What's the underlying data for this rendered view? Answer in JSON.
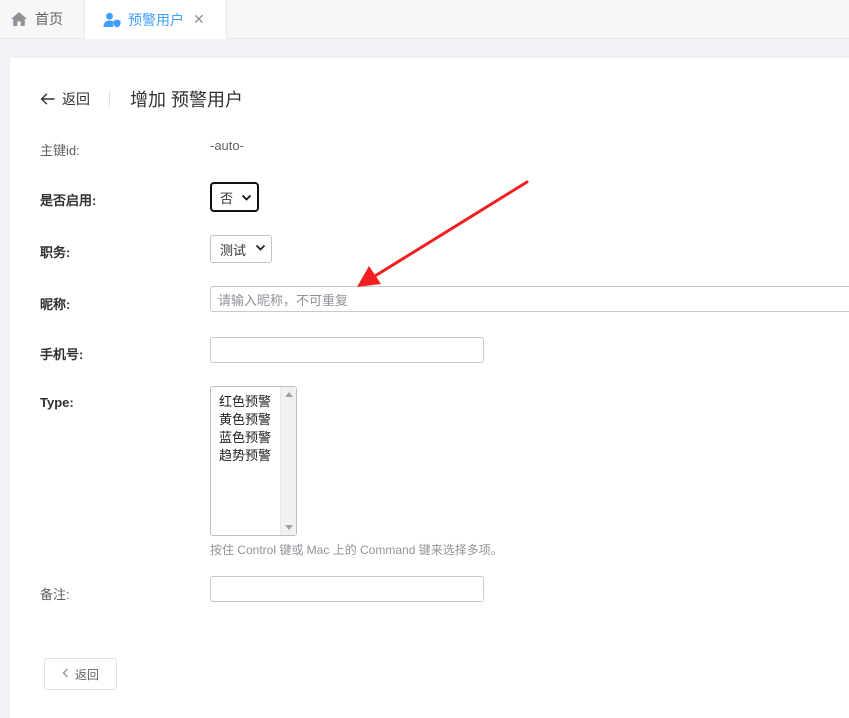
{
  "tabs": {
    "home": {
      "label": "首页",
      "icon": "home-icon"
    },
    "active": {
      "label": "预警用户",
      "icon": "user-shield-icon",
      "close": "✕"
    }
  },
  "header": {
    "back_label": "返回",
    "title": "增加 预警用户"
  },
  "form": {
    "pk": {
      "label": "主键id:",
      "value": "-auto-"
    },
    "enabled": {
      "label": "是否启用:",
      "selected": "否"
    },
    "position": {
      "label": "职务:",
      "selected": "测试"
    },
    "nickname": {
      "label": "昵称:",
      "placeholder": "请输入昵称，不可重复"
    },
    "phone": {
      "label": "手机号:",
      "value": ""
    },
    "type": {
      "label": "Type:",
      "options": [
        "红色预警",
        "黄色预警",
        "蓝色预警",
        "趋势预警"
      ],
      "help": "按住 Control 键或 Mac 上的 Command 键来选择多项。"
    },
    "remark": {
      "label": "备注:",
      "value": ""
    }
  },
  "footer": {
    "back_button": "返回"
  },
  "colors": {
    "accent": "#409eff",
    "annotation_arrow": "#f02020"
  }
}
